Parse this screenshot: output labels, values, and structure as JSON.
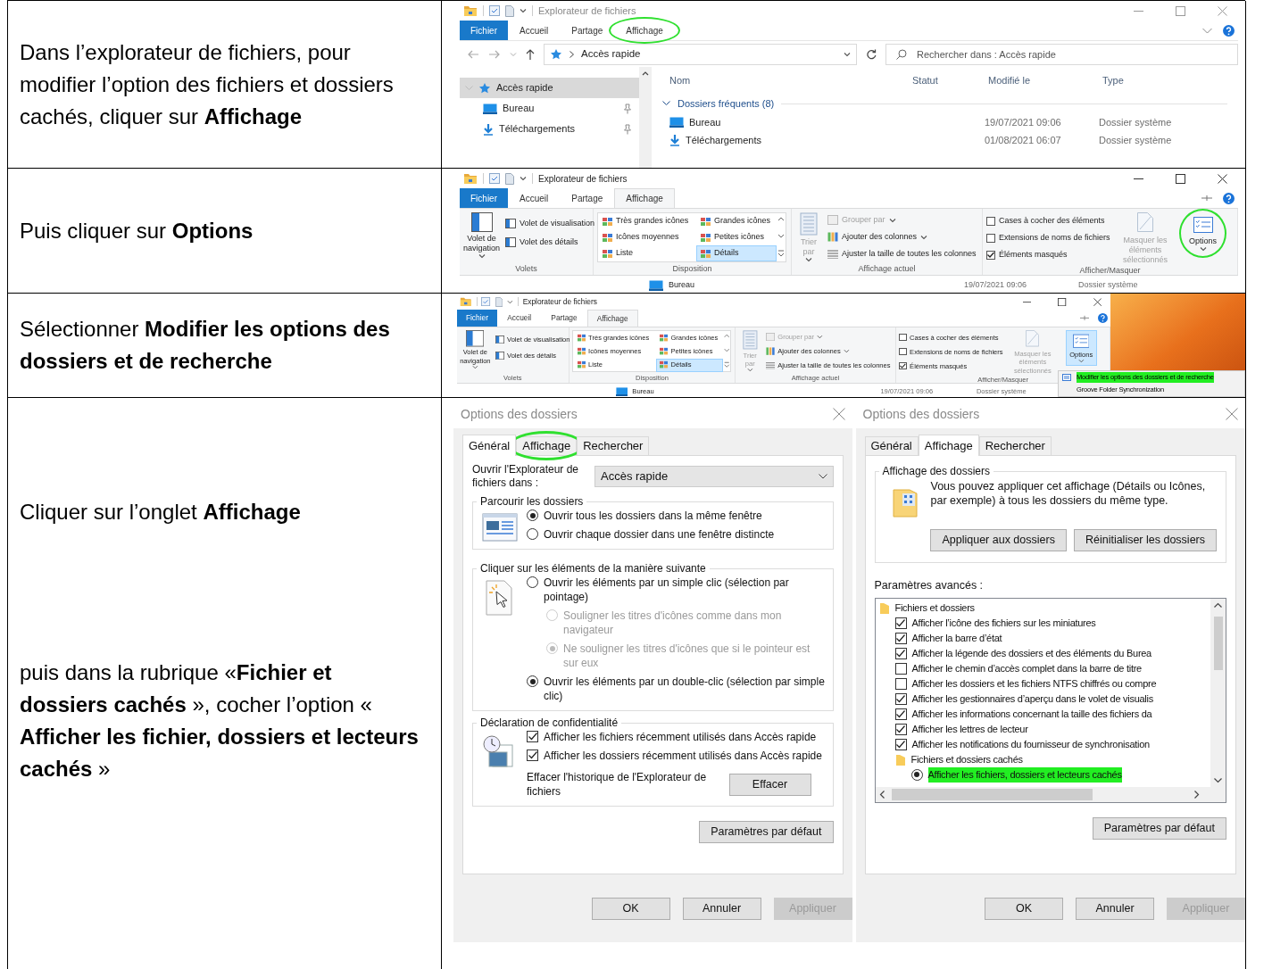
{
  "steps": [
    {
      "kind": "explorer",
      "instruction": [
        "Dans l’explorateur de fichiers, pour modifier l’option des fichiers et dossiers cachés, cliquer sur **Affichage**"
      ],
      "screen": {
        "title": "Explorateur de fichiers",
        "tabs": [
          {
            "label": "Fichier",
            "kind": "file",
            "selected": false,
            "circled": false
          },
          {
            "label": "Accueil",
            "kind": "tab",
            "selected": false,
            "circled": false
          },
          {
            "label": "Partage",
            "kind": "tab",
            "selected": false,
            "circled": false
          },
          {
            "label": "Affichage",
            "kind": "tab",
            "selected": false,
            "circled": true
          }
        ],
        "address": "Accès rapide",
        "search": {
          "placeholder": "Rechercher dans : Accès rapide"
        },
        "nav": [
          {
            "label": "Accès rapide",
            "kind": "star",
            "selected": true,
            "pinned": false
          },
          {
            "label": "Bureau",
            "kind": "desktop",
            "selected": false,
            "pinned": true
          },
          {
            "label": "Téléchargements",
            "kind": "download",
            "selected": false,
            "pinned": true
          }
        ],
        "columns": [
          "Nom",
          "Statut",
          "Modifié le",
          "Type"
        ],
        "group": "Dossiers fréquents (8)",
        "files": [
          {
            "name": "Bureau",
            "kind": "desktop",
            "modified": "19/07/2021 09:06",
            "type": "Dossier système"
          },
          {
            "name": "Téléchargements",
            "kind": "download",
            "modified": "01/08/2021 06:07",
            "type": "Dossier système"
          }
        ]
      }
    },
    {
      "kind": "ribbon",
      "instruction": [
        "Puis cliquer sur **Options**"
      ],
      "screen": {
        "title": "Explorateur de fichiers",
        "tabs": [
          {
            "label": "Fichier",
            "kind": "file",
            "selected": false,
            "circled": false
          },
          {
            "label": "Accueil",
            "kind": "tab",
            "selected": false,
            "circled": false
          },
          {
            "label": "Partage",
            "kind": "tab",
            "selected": false,
            "circled": false
          },
          {
            "label": "Affichage",
            "kind": "tab",
            "selected": true,
            "circled": false
          }
        ],
        "groups": [
          {
            "kind": "panes",
            "label": "Volets",
            "large": {
              "label": "Volet de navigation",
              "dropdown": true
            },
            "items": [
              "Volet de visualisation",
              "Volet des détails"
            ]
          },
          {
            "kind": "layout",
            "label": "Disposition",
            "items": [
              {
                "label": "Très grandes icônes",
                "selected": false
              },
              {
                "label": "Grandes icônes",
                "selected": false
              },
              {
                "label": "Icônes moyennes",
                "selected": false
              },
              {
                "label": "Petites icônes",
                "selected": false
              },
              {
                "label": "Liste",
                "selected": false
              },
              {
                "label": "Détails",
                "selected": true
              }
            ]
          },
          {
            "kind": "current",
            "label": "Affichage actuel",
            "sort": {
              "label": "Trier par",
              "disabled": true
            },
            "items": [
              {
                "label": "Grouper par",
                "disabled": true,
                "dropdown": true
              },
              {
                "label": "Ajouter des colonnes",
                "disabled": false,
                "dropdown": true
              },
              {
                "label": "Ajuster la taille de toutes les colonnes",
                "disabled": false,
                "dropdown": false
              }
            ]
          },
          {
            "kind": "showhide",
            "label": "Afficher/Masquer",
            "checks": [
              {
                "label": "Cases à cocher des éléments",
                "checked": false
              },
              {
                "label": "Extensions de noms de fichiers",
                "checked": false
              },
              {
                "label": "Éléments masqués",
                "checked": true
              }
            ],
            "hide": {
              "label": "Masquer les éléments sélectionnés",
              "disabled": true
            },
            "options": {
              "label": "Options",
              "circled": true,
              "pressed": false
            }
          }
        ],
        "files": [
          {
            "name": "Bureau",
            "kind": "desktop",
            "modified": "19/07/2021 09:06",
            "type": "Dossier système"
          }
        ]
      }
    },
    {
      "kind": "ribbon_menu",
      "instruction": [
        "Sélectionner **Modifier les options des dossiers et de recherche**"
      ],
      "screen": {
        "title": "Explorateur de fichiers",
        "tabs": [
          {
            "label": "Fichier",
            "kind": "file",
            "selected": false,
            "circled": false
          },
          {
            "label": "Accueil",
            "kind": "tab",
            "selected": false,
            "circled": false
          },
          {
            "label": "Partage",
            "kind": "tab",
            "selected": false,
            "circled": false
          },
          {
            "label": "Affichage",
            "kind": "tab",
            "selected": true,
            "circled": false
          }
        ],
        "groups": [
          {
            "kind": "panes",
            "label": "Volets",
            "large": {
              "label": "Volet de navigation",
              "dropdown": true
            },
            "items": [
              "Volet de visualisation",
              "Volet des détails"
            ]
          },
          {
            "kind": "layout",
            "label": "Disposition",
            "items": [
              {
                "label": "Très grandes icônes",
                "selected": false
              },
              {
                "label": "Grandes icônes",
                "selected": false
              },
              {
                "label": "Icônes moyennes",
                "selected": false
              },
              {
                "label": "Petites icônes",
                "selected": false
              },
              {
                "label": "Liste",
                "selected": false
              },
              {
                "label": "Détails",
                "selected": true
              }
            ]
          },
          {
            "kind": "current",
            "label": "Affichage actuel",
            "sort": {
              "label": "Trier par",
              "disabled": true
            },
            "items": [
              {
                "label": "Grouper par",
                "disabled": true,
                "dropdown": true
              },
              {
                "label": "Ajouter des colonnes",
                "disabled": false,
                "dropdown": true
              },
              {
                "label": "Ajuster la taille de toutes les colonnes",
                "disabled": false,
                "dropdown": false
              }
            ]
          },
          {
            "kind": "showhide",
            "label": "Afficher/Masquer",
            "checks": [
              {
                "label": "Cases à cocher des éléments",
                "checked": false
              },
              {
                "label": "Extensions de noms de fichiers",
                "checked": false
              },
              {
                "label": "Éléments masqués",
                "checked": true
              }
            ],
            "hide": {
              "label": "Masquer les éléments sélectionnés",
              "disabled": true
            },
            "options": {
              "label": "Options",
              "circled": false,
              "pressed": true
            }
          }
        ],
        "files": [
          {
            "name": "Bureau",
            "kind": "desktop",
            "modified": "19/07/2021 09:06",
            "type": "Dossier système"
          }
        ],
        "menu": [
          {
            "label": "Modifier les options des dossiers et de recherche",
            "highlighted": true
          },
          {
            "label": "Groove Folder Synchronization",
            "highlighted": false
          }
        ]
      }
    },
    {
      "kind": "dialogs",
      "instruction": [
        "Cliquer sur l’onglet **Affichage**",
        "puis dans la rubrique «**Fichier et dossiers cachés** », cocher l’option « **Afficher les fichier, dossiers et lecteurs cachés** »"
      ],
      "dialogs": [
        {
          "kind": "general",
          "title": "Options des dossiers",
          "tabs": [
            {
              "label": "Général",
              "selected": true,
              "circled": false
            },
            {
              "label": "Affichage",
              "selected": false,
              "circled": true
            },
            {
              "label": "Rechercher",
              "selected": false,
              "circled": false
            }
          ],
          "open_in": {
            "label": "Ouvrir l'Explorateur de fichiers dans :",
            "value": "Accès rapide"
          },
          "groups": [
            {
              "kind": "window",
              "title": "Parcourir les dossiers",
              "options": [
                {
                  "kind": "radio",
                  "label": "Ouvrir tous les dossiers dans la même fenêtre",
                  "checked": true,
                  "disabled": false
                },
                {
                  "kind": "radio",
                  "label": "Ouvrir chaque dossier dans une fenêtre distincte",
                  "checked": false,
                  "disabled": false
                }
              ]
            },
            {
              "kind": "cursor",
              "title": "Cliquer sur les éléments de la manière suivante",
              "options": [
                {
                  "kind": "radio",
                  "label": "Ouvrir les éléments par un simple clic (sélection par pointage)",
                  "checked": false,
                  "disabled": false,
                  "children": [
                    {
                      "kind": "radio",
                      "label": "Souligner les titres d'icônes comme dans mon navigateur",
                      "checked": false,
                      "disabled": true
                    },
                    {
                      "kind": "radio",
                      "label": "Ne souligner les titres d'icônes que si le pointeur est sur eux",
                      "checked": true,
                      "disabled": true
                    }
                  ]
                },
                {
                  "kind": "radio",
                  "label": "Ouvrir les éléments par un double-clic (sélection par simple clic)",
                  "checked": true,
                  "disabled": false
                }
              ]
            },
            {
              "kind": "clock",
              "title": "Déclaration de confidentialité",
              "options": [
                {
                  "kind": "checkbox",
                  "label": "Afficher les fichiers récemment utilisés dans Accès rapide",
                  "checked": true,
                  "disabled": false
                },
                {
                  "kind": "checkbox",
                  "label": "Afficher les dossiers récemment utilisés dans Accès rapide",
                  "checked": true,
                  "disabled": false
                }
              ],
              "clear": {
                "label": "Effacer l'historique de l'Explorateur de fichiers",
                "button": "Effacer"
              }
            }
          ],
          "default_button": "Paramètres par défaut",
          "footer": [
            {
              "label": "OK",
              "disabled": false
            },
            {
              "label": "Annuler",
              "disabled": false
            },
            {
              "label": "Appliquer",
              "disabled": true
            }
          ]
        },
        {
          "kind": "view",
          "title": "Options des dossiers",
          "tabs": [
            {
              "label": "Général",
              "selected": false,
              "circled": false
            },
            {
              "label": "Affichage",
              "selected": true,
              "circled": false
            },
            {
              "label": "Rechercher",
              "selected": false,
              "circled": false
            }
          ],
          "folder_views": {
            "title": "Affichage des dossiers",
            "text": "Vous pouvez appliquer cet affichage (Détails ou Icônes, par exemple) à tous les dossiers du même type.",
            "buttons": [
              "Appliquer aux dossiers",
              "Réinitialiser les dossiers"
            ]
          },
          "advanced_label": "Paramètres avancés :",
          "tree": [
            {
              "kind": "folder",
              "label": "Fichiers et dossiers",
              "children": [
                {
                  "kind": "checkbox",
                  "label": "Afficher l’icône des fichiers sur les miniatures",
                  "checked": true
                },
                {
                  "kind": "checkbox",
                  "label": "Afficher la barre d’état",
                  "checked": true
                },
                {
                  "kind": "checkbox",
                  "label": "Afficher la légende des dossiers et des éléments du Burea",
                  "checked": true
                },
                {
                  "kind": "checkbox",
                  "label": "Afficher le chemin d’accès complet dans la barre de titre",
                  "checked": false
                },
                {
                  "kind": "checkbox",
                  "label": "Afficher les dossiers et les fichiers NTFS chiffrés ou compre",
                  "checked": false
                },
                {
                  "kind": "checkbox",
                  "label": "Afficher les gestionnaires d’aperçu dans le volet de visualis",
                  "checked": true
                },
                {
                  "kind": "checkbox",
                  "label": "Afficher les informations concernant la taille des fichiers da",
                  "checked": true
                },
                {
                  "kind": "checkbox",
                  "label": "Afficher les lettres de lecteur",
                  "checked": true
                },
                {
                  "kind": "checkbox",
                  "label": "Afficher les notifications du fournisseur de synchronisation",
                  "checked": true
                },
                {
                  "kind": "folder",
                  "label": "Fichiers et dossiers cachés",
                  "children": [
                    {
                      "kind": "radio",
                      "label": "Afficher les fichiers, dossiers et lecteurs cachés",
                      "checked": true,
                      "highlighted": true
                    }
                  ]
                }
              ]
            }
          ],
          "default_button": "Paramètres par défaut",
          "footer": [
            {
              "label": "OK",
              "disabled": false
            },
            {
              "label": "Annuler",
              "disabled": false
            },
            {
              "label": "Appliquer",
              "disabled": true
            }
          ]
        }
      ]
    }
  ]
}
